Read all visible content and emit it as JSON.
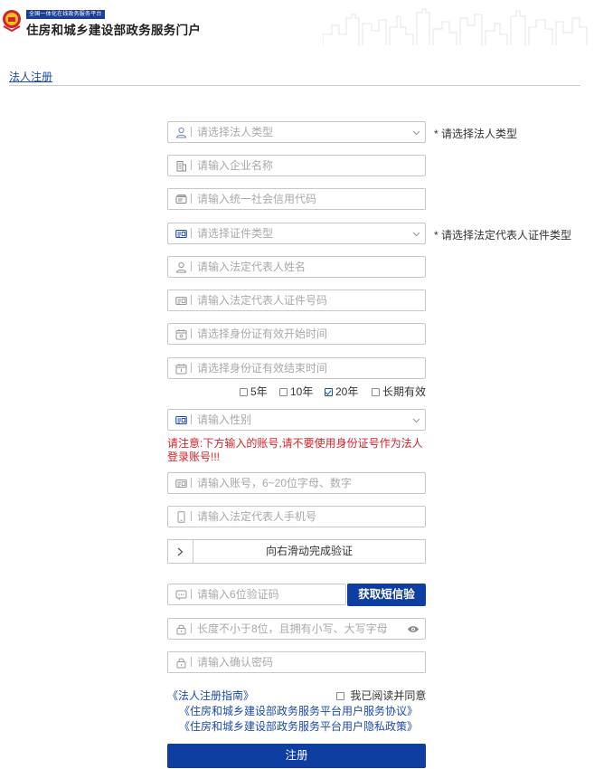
{
  "header": {
    "platform_tag": "全国一体化在线政务服务平台",
    "site_title": "住房和城乡建设部政务服务门户"
  },
  "tab": {
    "label": "法人注册"
  },
  "form": {
    "legal_type": {
      "placeholder": "请选择法人类型",
      "hint": "* 请选择法人类型"
    },
    "company_name": {
      "placeholder": "请输入企业名称"
    },
    "credit_code": {
      "placeholder": "请输入统一社会信用代码"
    },
    "cert_type": {
      "placeholder": "请选择证件类型",
      "hint": "* 请选择法定代表人证件类型"
    },
    "rep_name": {
      "placeholder": "请输入法定代表人姓名"
    },
    "rep_cert_no": {
      "placeholder": "请输入法定代表人证件号码"
    },
    "id_start": {
      "placeholder": "请选择身份证有效开始时间"
    },
    "id_end": {
      "placeholder": "请选择身份证有效结束时间"
    },
    "validity_options": [
      {
        "label": "5年",
        "checked": false
      },
      {
        "label": "10年",
        "checked": false
      },
      {
        "label": "20年",
        "checked": true
      },
      {
        "label": "长期有效",
        "checked": false
      }
    ],
    "gender": {
      "placeholder": "请输入性别"
    },
    "warning": "请注意:下方输入的账号,请不要使用身份证号作为法人登录账号!!!",
    "account": {
      "placeholder": "请输入账号，6~20位字母、数字"
    },
    "phone": {
      "placeholder": "请输入法定代表人手机号"
    },
    "slider": {
      "label": "向右滑动完成验证"
    },
    "sms_code": {
      "placeholder": "请输入6位验证码",
      "button": "获取短信验"
    },
    "password": {
      "placeholder": "长度不小于8位，且拥有小写、大写字母"
    },
    "confirm_password": {
      "placeholder": "请输入确认密码"
    }
  },
  "links": {
    "guide": "《法人注册指南》",
    "agree_label": "我已阅读并同意",
    "service_agreement": "《住房和城乡建设部政务服务平台用户服务协议》",
    "privacy_policy": "《住房和城乡建设部政务服务平台用户隐私政策》"
  },
  "submit_label": "注册",
  "colors": {
    "primary": "#0f3ea3",
    "link": "#1d4aa8",
    "warning": "#d4222a"
  }
}
